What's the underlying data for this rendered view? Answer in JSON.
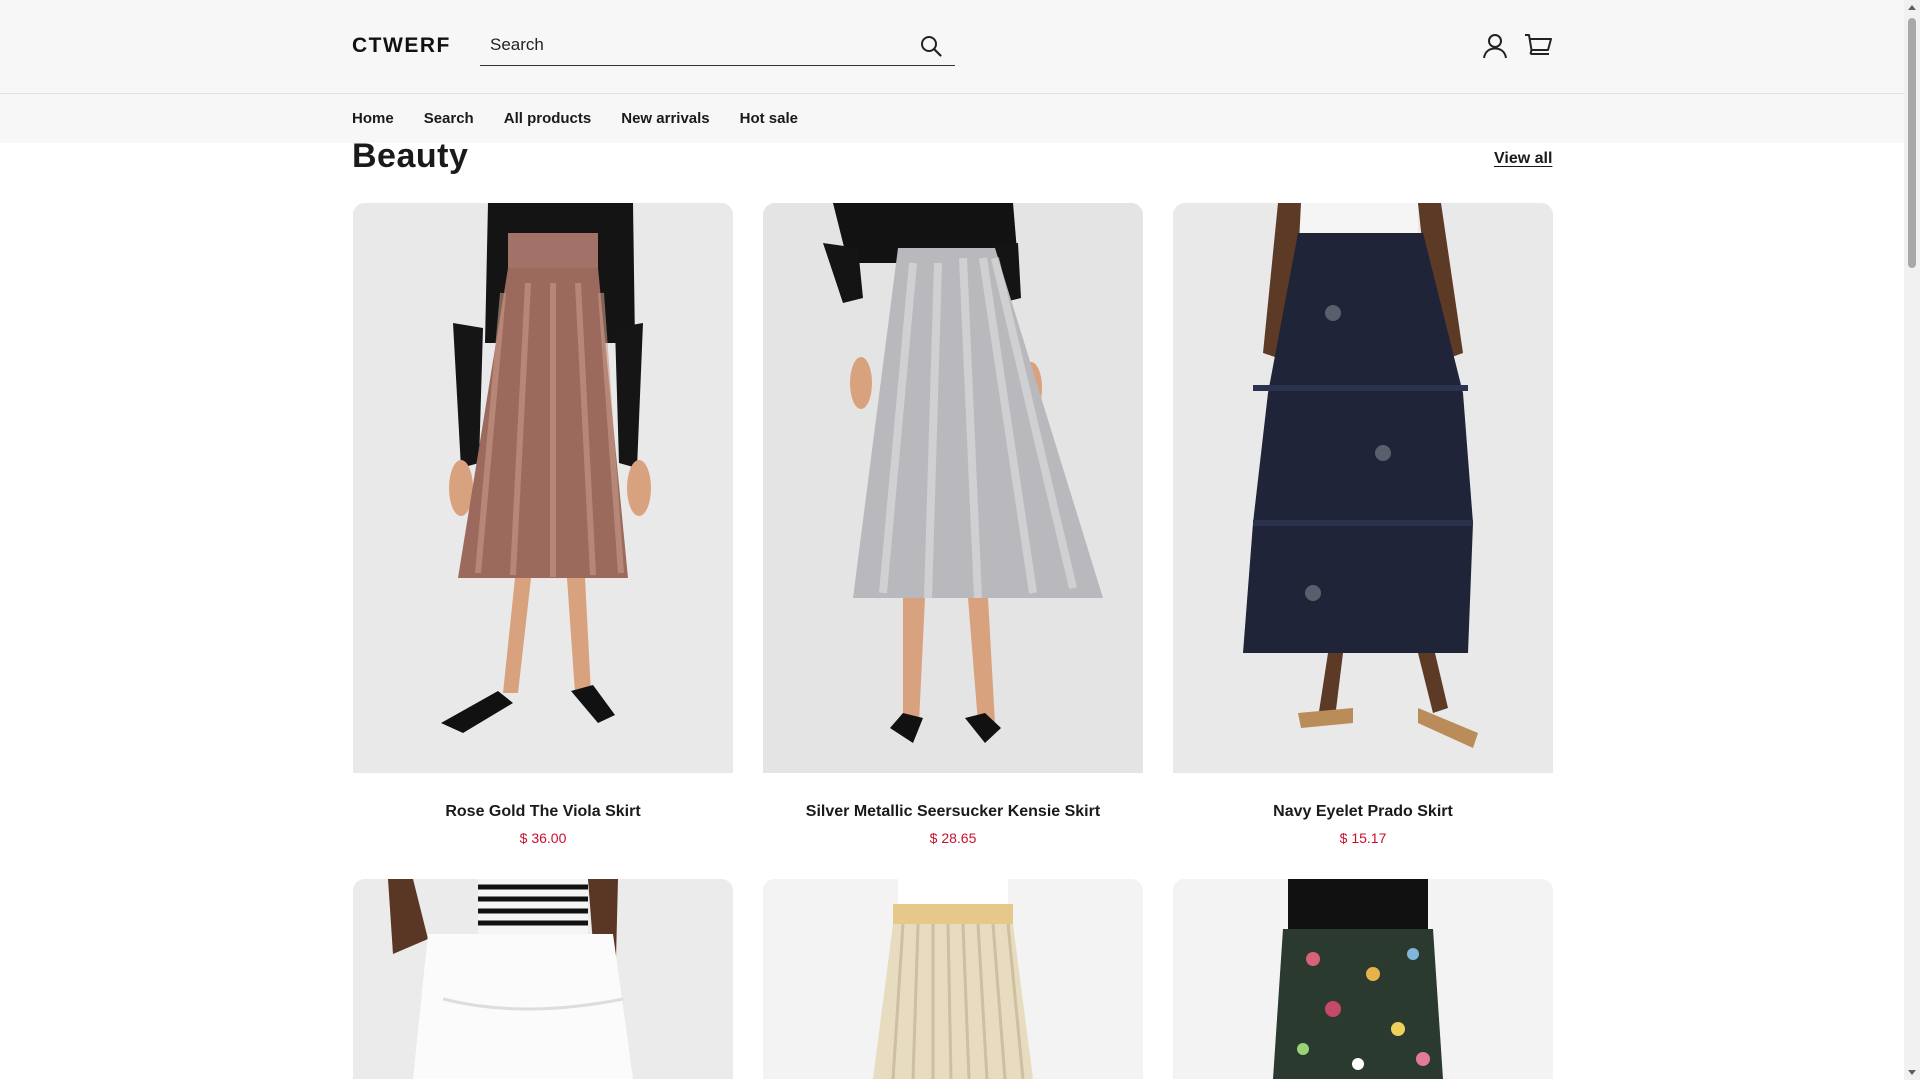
{
  "header": {
    "logo": "CTWERF",
    "search_placeholder": "Search"
  },
  "nav": {
    "items": [
      {
        "label": "Home"
      },
      {
        "label": "Search"
      },
      {
        "label": "All products"
      },
      {
        "label": "New arrivals"
      },
      {
        "label": "Hot sale"
      }
    ]
  },
  "section": {
    "title": "Beauty",
    "view_all": "View all"
  },
  "products": [
    {
      "name": "Rose Gold The Viola Skirt",
      "price": "$ 36.00"
    },
    {
      "name": "Silver Metallic Seersucker Kensie Skirt",
      "price": "$ 28.65"
    },
    {
      "name": "Navy Eyelet Prado Skirt",
      "price": "$ 15.17"
    }
  ],
  "colors": {
    "price": "#c8102e",
    "header_bg": "#f7f7f7"
  }
}
